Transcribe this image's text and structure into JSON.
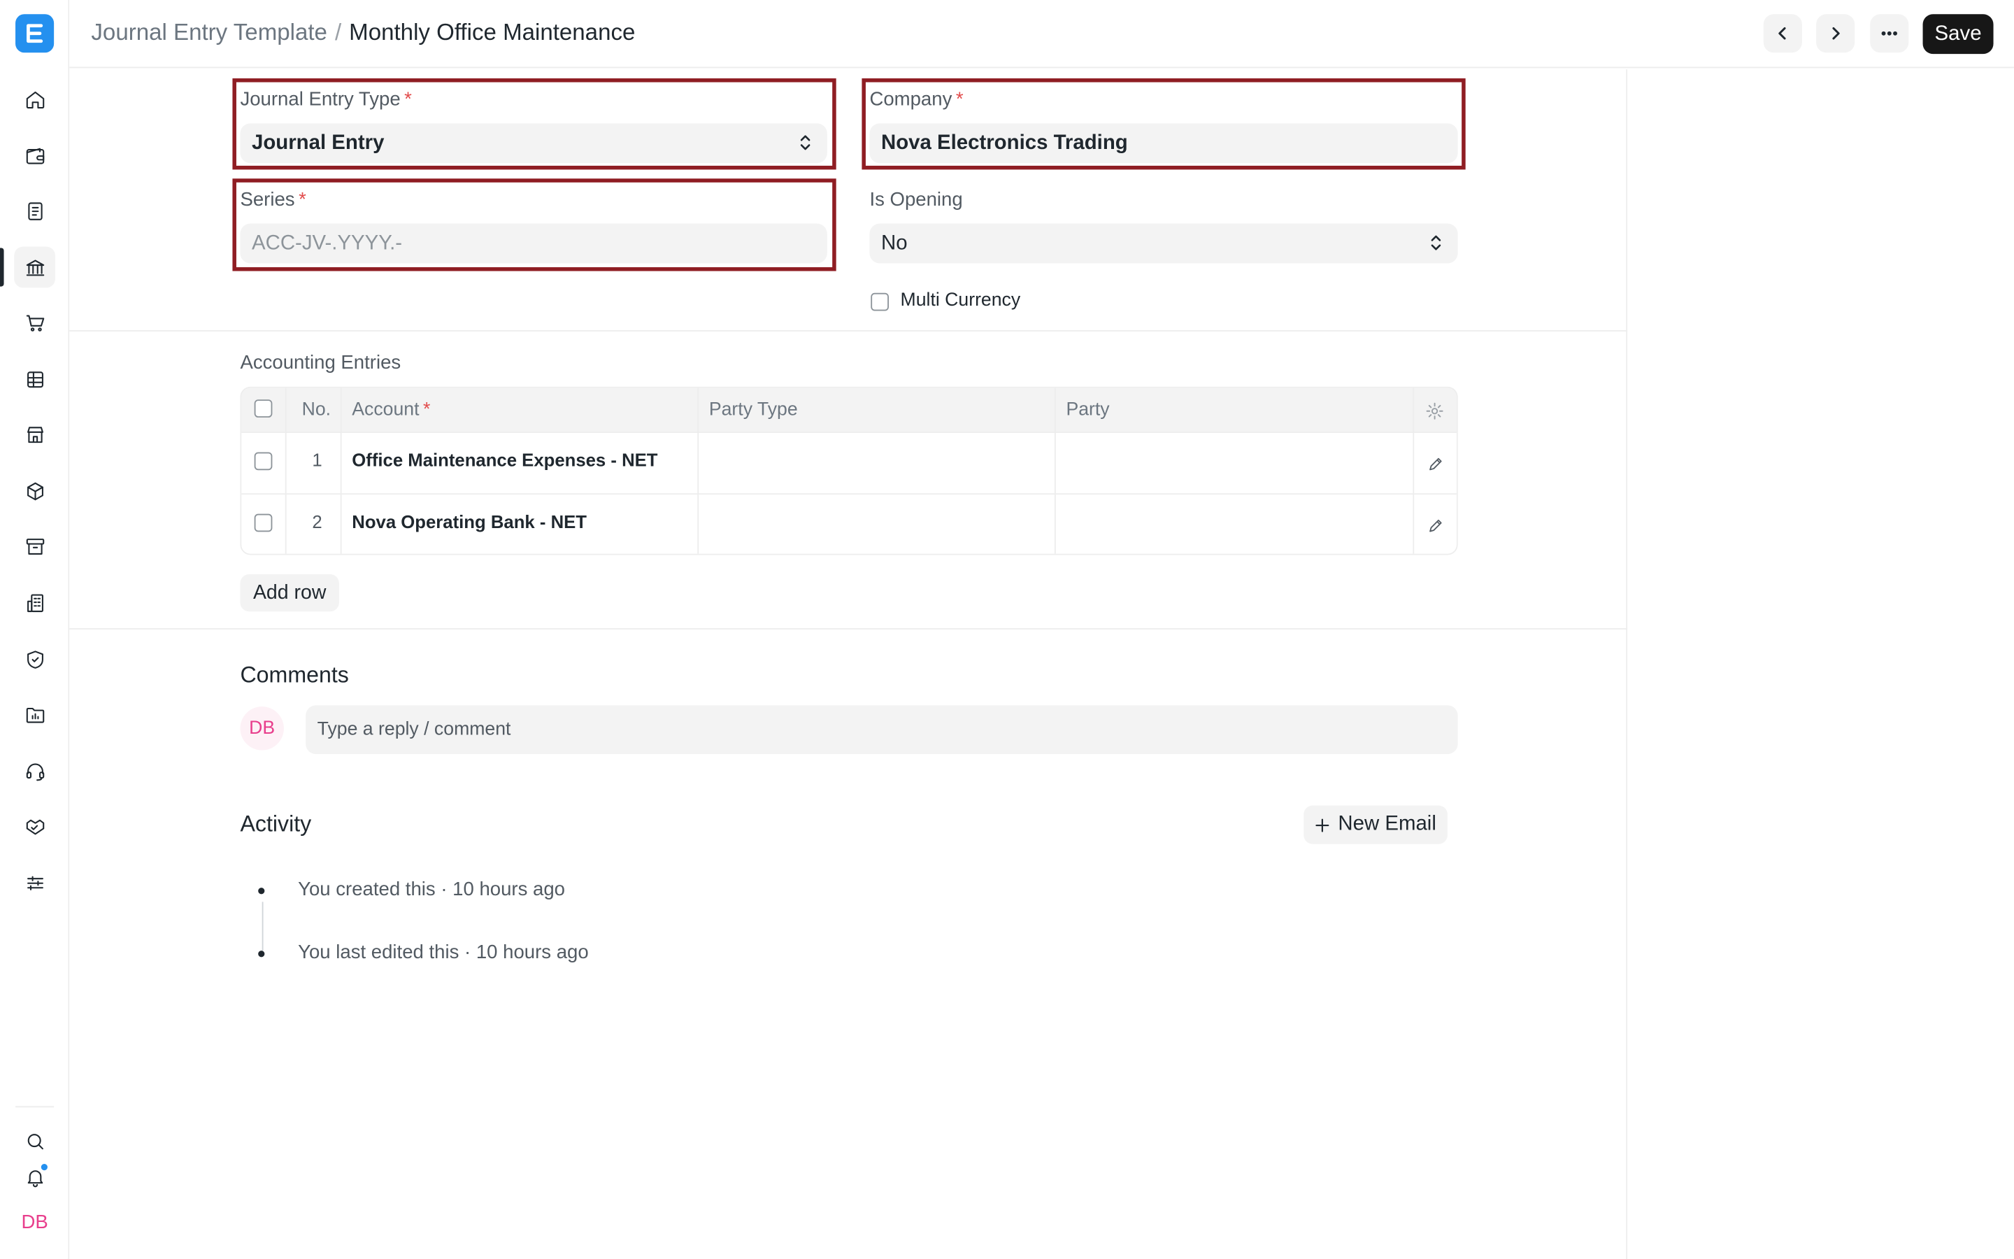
{
  "header": {
    "breadcrumb_parent": "Journal Entry Template",
    "breadcrumb_separator": "/",
    "title": "Monthly Office Maintenance",
    "save_label": "Save"
  },
  "sidebar": {
    "items": [
      {
        "icon": "home-icon"
      },
      {
        "icon": "wallet-icon"
      },
      {
        "icon": "file-text-icon"
      },
      {
        "icon": "bank-icon",
        "active": true
      },
      {
        "icon": "shopping-cart-icon"
      },
      {
        "icon": "table-icon"
      },
      {
        "icon": "store-icon"
      },
      {
        "icon": "package-icon"
      },
      {
        "icon": "archive-icon"
      },
      {
        "icon": "building-icon"
      },
      {
        "icon": "shield-icon"
      },
      {
        "icon": "folder-chart-icon"
      },
      {
        "icon": "headset-icon"
      },
      {
        "icon": "handshake-icon"
      },
      {
        "icon": "sliders-icon"
      }
    ],
    "bottom": {
      "search": "search-icon",
      "notifications": "bell-icon",
      "avatar_initials": "DB"
    }
  },
  "form": {
    "journal_entry_type": {
      "label": "Journal Entry Type",
      "value": "Journal Entry",
      "required": "*"
    },
    "company": {
      "label": "Company",
      "value": "Nova Electronics Trading",
      "required": "*"
    },
    "series": {
      "label": "Series",
      "placeholder": "ACC-JV-.YYYY.-",
      "required": "*"
    },
    "is_opening": {
      "label": "Is Opening",
      "value": "No"
    },
    "multi_currency": {
      "label": "Multi Currency",
      "checked": false
    }
  },
  "accounting_entries": {
    "title": "Accounting Entries",
    "columns": {
      "no": "No.",
      "account": "Account",
      "account_required": "*",
      "party_type": "Party Type",
      "party": "Party"
    },
    "rows": [
      {
        "no": "1",
        "account": "Office Maintenance Expenses - NET",
        "party_type": "",
        "party": ""
      },
      {
        "no": "2",
        "account": "Nova Operating Bank - NET",
        "party_type": "",
        "party": ""
      }
    ],
    "add_row_label": "Add row"
  },
  "comments": {
    "title": "Comments",
    "avatar_initials": "DB",
    "placeholder": "Type a reply / comment"
  },
  "activity": {
    "title": "Activity",
    "new_email_label": "New Email",
    "items": [
      {
        "text": "You created this · 10 hours ago"
      },
      {
        "text": "You last edited this · 10 hours ago"
      }
    ]
  },
  "colors": {
    "highlight_border": "#8f1d23",
    "brand_blue": "#2490ef",
    "required_red": "#e24c4c",
    "avatar_pink": "#e83e8c"
  }
}
